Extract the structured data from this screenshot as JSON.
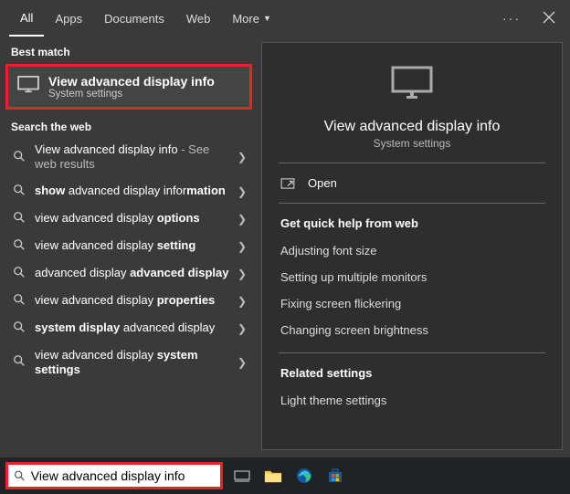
{
  "tabs": {
    "all": "All",
    "apps": "Apps",
    "documents": "Documents",
    "web": "Web",
    "more": "More"
  },
  "groups": {
    "best": "Best match",
    "web": "Search the web"
  },
  "best_match": {
    "title": "View advanced display info",
    "subtitle": "System settings"
  },
  "web_results": [
    {
      "prefix": "View advanced display info",
      "suffix": " - See web results",
      "bold_ranges": []
    },
    {
      "html": "<b>show</b> advanced display infor<b>mation</b>"
    },
    {
      "html": "view advanced display <b>options</b>"
    },
    {
      "html": "view advanced display <b>setting</b>"
    },
    {
      "html": "advanced display <b>advanced display</b>"
    },
    {
      "html": "view advanced display <b>properties</b>"
    },
    {
      "html": "<b>system display</b> advanced display"
    },
    {
      "html": "view advanced display <b>system settings</b>"
    }
  ],
  "preview": {
    "title": "View advanced display info",
    "subtitle": "System settings",
    "open": "Open",
    "quick_help_header": "Get quick help from web",
    "quick_help": [
      "Adjusting font size",
      "Setting up multiple monitors",
      "Fixing screen flickering",
      "Changing screen brightness"
    ],
    "related_header": "Related settings",
    "related": [
      "Light theme settings"
    ]
  },
  "taskbar": {
    "search_value": "View advanced display info"
  }
}
